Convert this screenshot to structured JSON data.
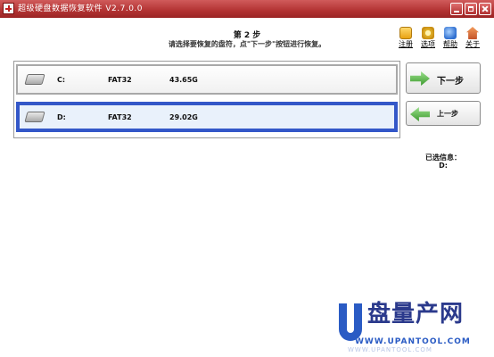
{
  "window": {
    "title": "超级硬盘数据恢复软件 V2.7.0.0"
  },
  "header": {
    "step": "第 2 步",
    "instruction": "请选择要恢复的盘符，点\"下一步\"按钮进行恢复。"
  },
  "toolbar": {
    "items": [
      {
        "label": "注册",
        "icon": "register-icon"
      },
      {
        "label": "选项",
        "icon": "options-icon"
      },
      {
        "label": "帮助",
        "icon": "help-icon"
      },
      {
        "label": "关于",
        "icon": "about-icon"
      }
    ]
  },
  "drives": [
    {
      "letter": "C:",
      "filesystem": "FAT32",
      "size": "43.65G",
      "selected": false
    },
    {
      "letter": "D:",
      "filesystem": "FAT32",
      "size": "29.02G",
      "selected": true
    }
  ],
  "buttons": {
    "next": "下一步",
    "prev": "上一步"
  },
  "selection": {
    "label": "已选信息：",
    "value": "D:"
  },
  "watermark": {
    "brand": "盘量产网",
    "url": "WWW.UPANTOOL.COM",
    "faint": "WWW.UPANTOOL.COM"
  },
  "colors": {
    "titlebar": "#b23232",
    "selection_border": "#3357c8",
    "selected_row_bg": "#e9f1fb",
    "arrow_green": "#3d9a2e",
    "watermark_blue": "#2a5bc4"
  }
}
